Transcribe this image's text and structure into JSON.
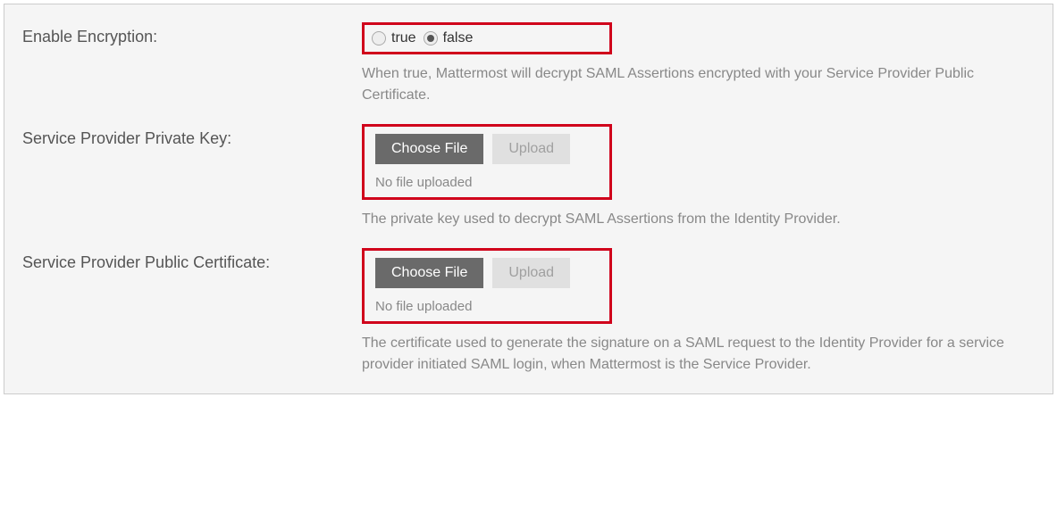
{
  "enableEncryption": {
    "label": "Enable Encryption:",
    "trueLabel": "true",
    "falseLabel": "false",
    "selected": "false",
    "help": "When true, Mattermost will decrypt SAML Assertions encrypted with your Service Provider Public Certificate."
  },
  "privateKey": {
    "label": "Service Provider Private Key:",
    "chooseBtn": "Choose File",
    "uploadBtn": "Upload",
    "status": "No file uploaded",
    "help": "The private key used to decrypt SAML Assertions from the Identity Provider."
  },
  "publicCert": {
    "label": "Service Provider Public Certificate:",
    "chooseBtn": "Choose File",
    "uploadBtn": "Upload",
    "status": "No file uploaded",
    "help": "The certificate used to generate the signature on a SAML request to the Identity Provider for a service provider initiated SAML login, when Mattermost is the Service Provider."
  }
}
